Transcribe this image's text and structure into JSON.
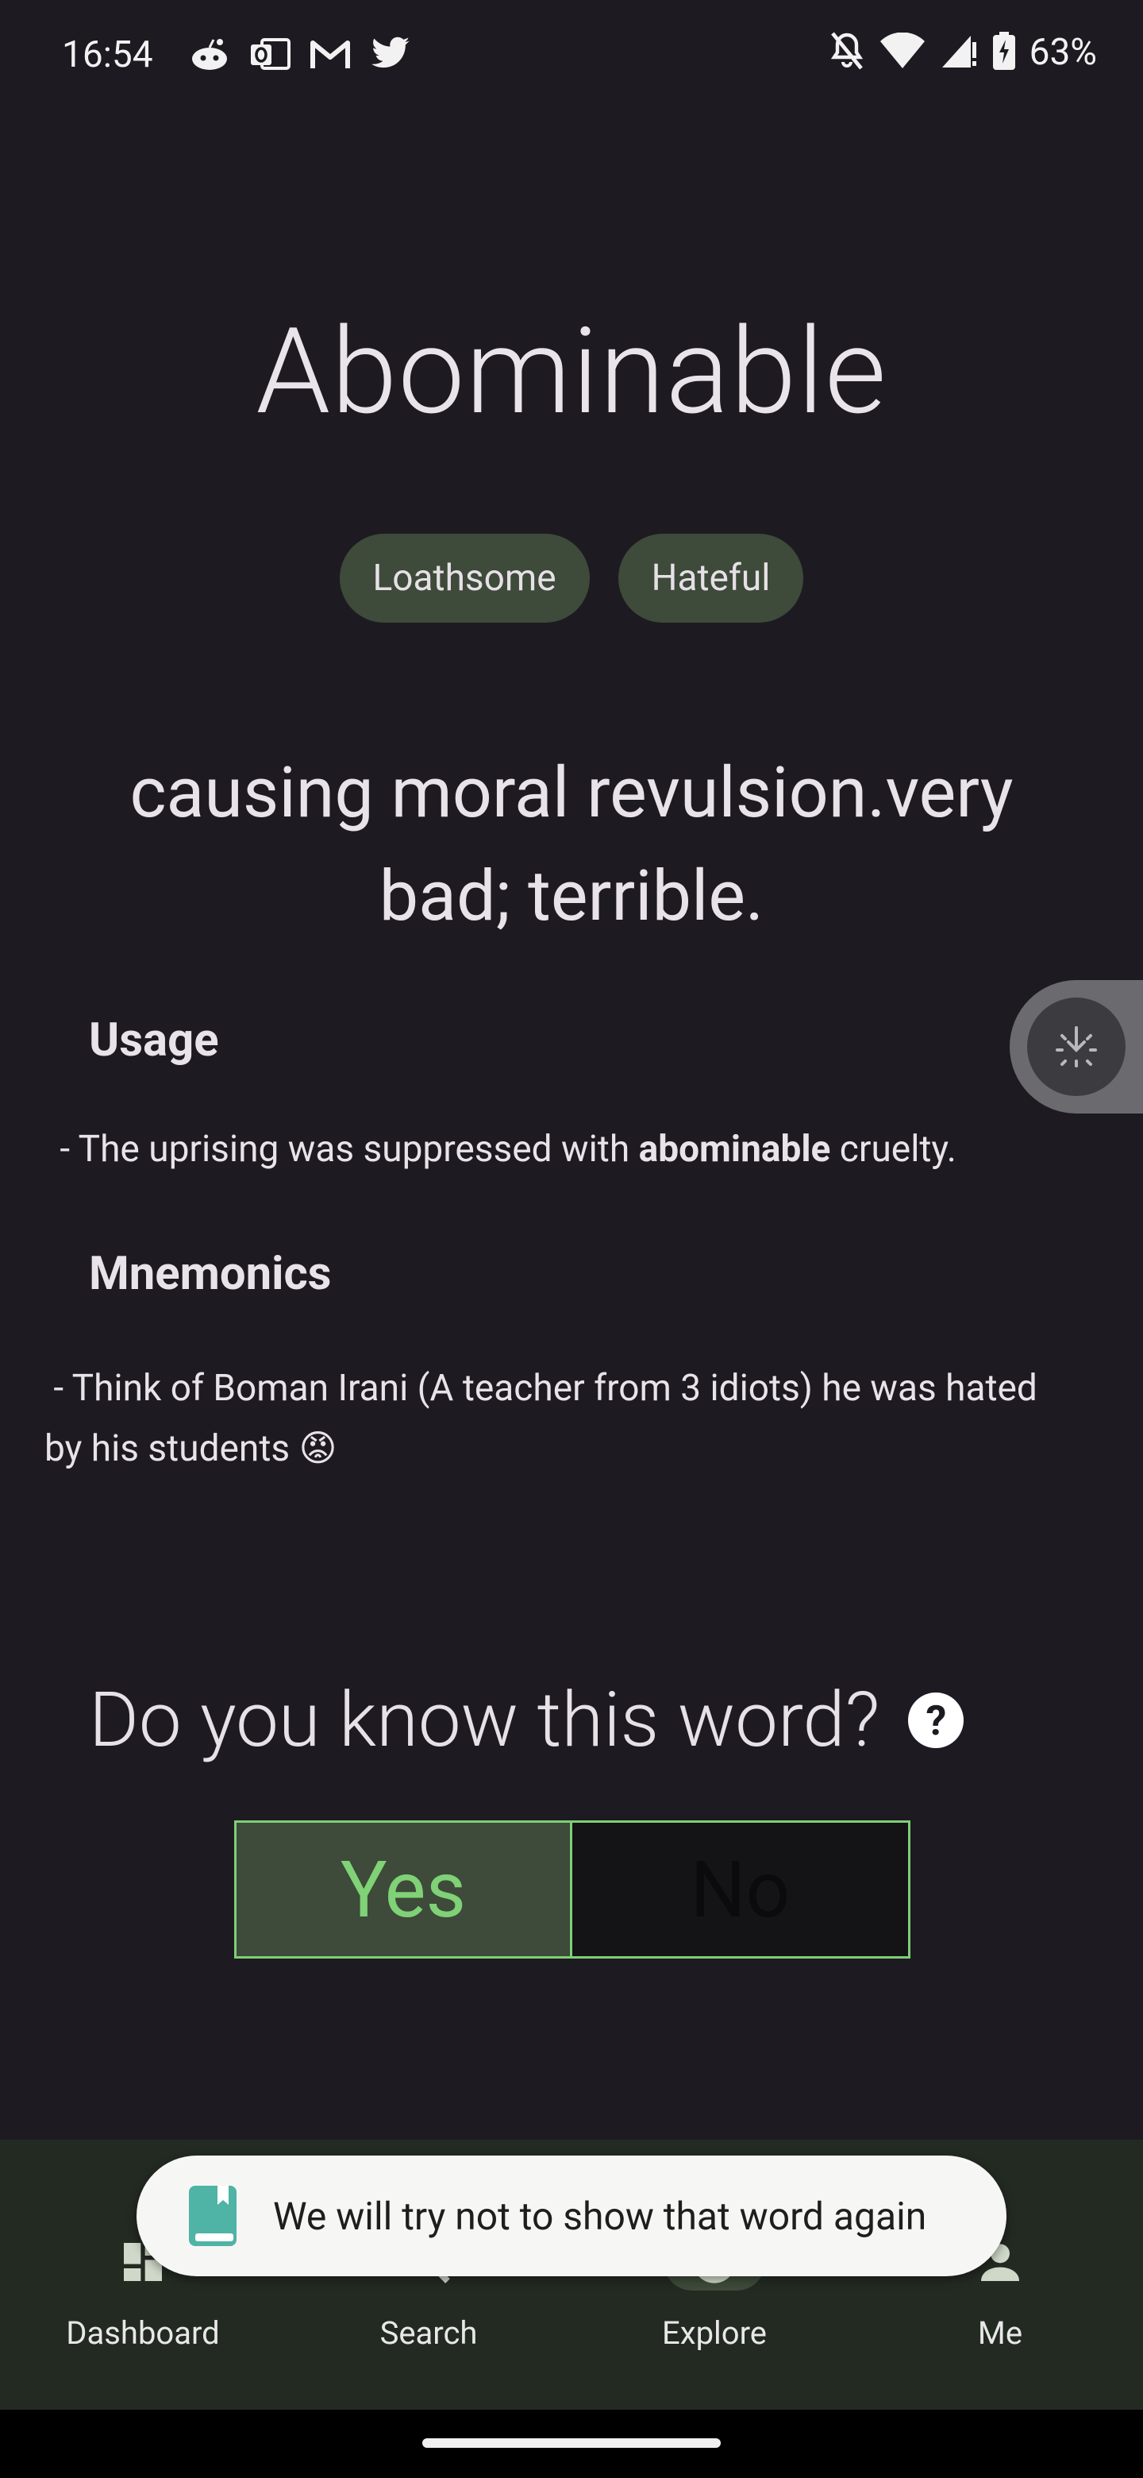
{
  "status_bar": {
    "time": "16:54",
    "left_icons": [
      "reddit-icon",
      "outlook-icon",
      "gmail-icon",
      "twitter-icon"
    ],
    "right_icons": [
      "mute-icon",
      "wifi-icon",
      "signal-icon",
      "battery-charging-icon"
    ],
    "battery": "63%"
  },
  "word": {
    "title": "Abominable",
    "synonyms": [
      "Loathsome",
      "Hateful"
    ],
    "definition": "causing moral revulsion.very bad; terrible."
  },
  "usage": {
    "title": "Usage",
    "prefix": " - The uprising was suppressed with ",
    "highlight": "abominable",
    "suffix": " cruelty."
  },
  "mnemonics": {
    "title": "Mnemonics",
    "text": " - Think of Boman Irani (A teacher from 3 idiots) he was hated by his students 😡"
  },
  "question": {
    "text": "Do you know this word?",
    "help_icon": "help-icon",
    "yes_label": "Yes",
    "no_label": "No"
  },
  "snackbar": {
    "text": "We will try not to show that word again",
    "icon": "book-icon"
  },
  "nav": {
    "items": [
      {
        "label": "Dashboard",
        "icon": "dashboard-icon"
      },
      {
        "label": "Search",
        "icon": "search-icon"
      },
      {
        "label": "Explore",
        "icon": "explore-icon",
        "active": true
      },
      {
        "label": "Me",
        "icon": "person-icon"
      }
    ]
  },
  "colors": {
    "background": "#1d1b21",
    "chip": "#3e4a3a",
    "accent_green": "#7fd276",
    "nav_background": "#232a22"
  }
}
